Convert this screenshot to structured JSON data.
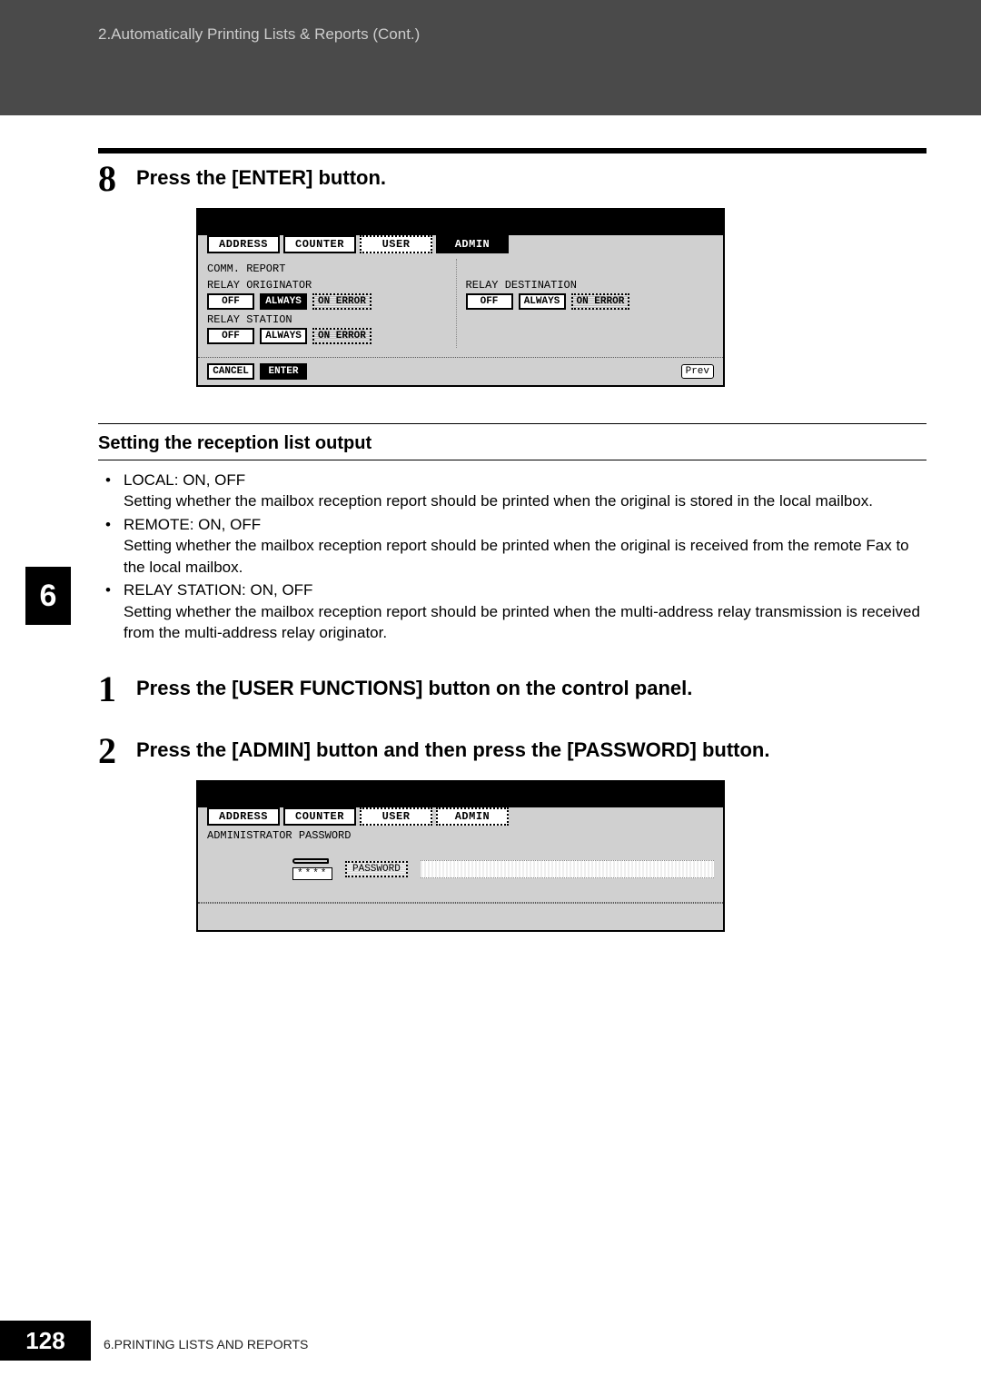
{
  "header": {
    "breadcrumb": "2.Automatically Printing Lists & Reports (Cont.)"
  },
  "chapter_tab": "6",
  "step8": {
    "num": "8",
    "title": "Press the [ENTER] button.",
    "screenshot": {
      "tabs": {
        "address": "ADDRESS",
        "counter": "COUNTER",
        "user": "USER",
        "admin": "ADMIN"
      },
      "section_label": "COMM. REPORT",
      "groups": {
        "relay_originator": {
          "label": "RELAY ORIGINATOR",
          "off": "OFF",
          "always": "ALWAYS",
          "on_error": "ON ERROR"
        },
        "relay_station": {
          "label": "RELAY STATION",
          "off": "OFF",
          "always": "ALWAYS",
          "on_error": "ON ERROR"
        },
        "relay_destination": {
          "label": "RELAY DESTINATION",
          "off": "OFF",
          "always": "ALWAYS",
          "on_error": "ON ERROR"
        }
      },
      "actions": {
        "cancel": "CANCEL",
        "enter": "ENTER",
        "prev": "Prev"
      }
    }
  },
  "subheading": "Setting the reception list output",
  "bullets": {
    "local_title": "LOCAL: ON, OFF",
    "local_desc": "Setting whether the mailbox reception report should be printed when the original is stored in the local mailbox.",
    "remote_title": "REMOTE: ON, OFF",
    "remote_desc": "Setting whether the mailbox reception report should be printed when the original is received from the remote Fax to the local mailbox.",
    "relay_title": "RELAY STATION: ON, OFF",
    "relay_desc": "Setting whether the mailbox reception report should be printed when the multi-address relay transmission is received from the multi-address relay originator."
  },
  "step1": {
    "num": "1",
    "title": "Press the [USER FUNCTIONS] button on the control panel."
  },
  "step2": {
    "num": "2",
    "title": "Press the [ADMIN] button and then press the [PASSWORD] button.",
    "screenshot": {
      "tabs": {
        "address": "ADDRESS",
        "counter": "COUNTER",
        "user": "USER",
        "admin": "ADMIN"
      },
      "top_label": "ADMINISTRATOR PASSWORD",
      "password_btn": "PASSWORD",
      "stars": "****"
    }
  },
  "footer": {
    "page_num": "128",
    "text": "6.PRINTING LISTS AND REPORTS"
  }
}
